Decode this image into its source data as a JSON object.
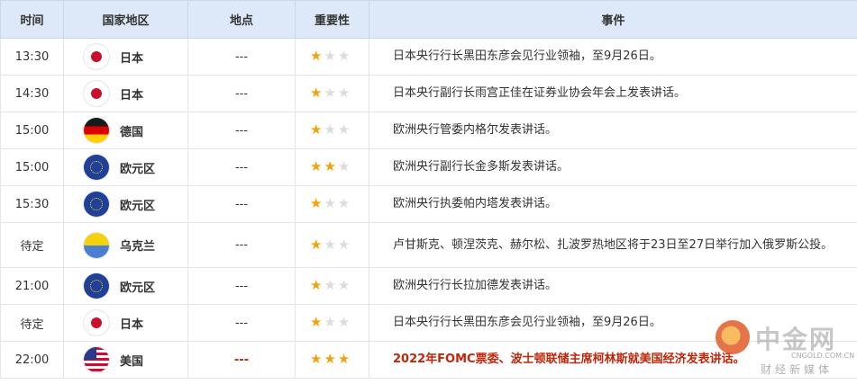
{
  "headers": {
    "time": "时间",
    "country": "国家地区",
    "location": "地点",
    "importance": "重要性",
    "event": "事件"
  },
  "rows": [
    {
      "time": "13:30",
      "flag": "japan-flag-icon",
      "country": "日本",
      "location": "---",
      "stars": 1,
      "event": "日本央行行长黑田东彦会见行业领袖，至9月26日。"
    },
    {
      "time": "14:30",
      "flag": "japan-flag-icon",
      "country": "日本",
      "location": "---",
      "stars": 1,
      "event": "日本央行副行长雨宫正佳在证券业协会年会上发表讲话。"
    },
    {
      "time": "15:00",
      "flag": "germany-flag-icon",
      "country": "德国",
      "location": "---",
      "stars": 1,
      "event": "欧洲央行管委内格尔发表讲话。"
    },
    {
      "time": "15:00",
      "flag": "eu-flag-icon",
      "country": "欧元区",
      "location": "---",
      "stars": 2,
      "event": "欧洲央行副行长金多斯发表讲话。"
    },
    {
      "time": "15:30",
      "flag": "eu-flag-icon",
      "country": "欧元区",
      "location": "---",
      "stars": 1,
      "event": "欧洲央行执委帕内塔发表讲话。"
    },
    {
      "time": "待定",
      "flag": "ukraine-flag-icon",
      "country": "乌克兰",
      "location": "---",
      "stars": 1,
      "event": "卢甘斯克、顿涅茨克、赫尔松、扎波罗热地区将于23日至27日举行加入俄罗斯公投。"
    },
    {
      "time": "21:00",
      "flag": "eu-flag-icon",
      "country": "欧元区",
      "location": "---",
      "stars": 1,
      "event": "欧洲央行行长拉加德发表讲话。"
    },
    {
      "time": "待定",
      "flag": "japan-flag-icon",
      "country": "日本",
      "location": "---",
      "stars": 1,
      "event": "日本央行行长黑田东彦会见行业领袖，至9月26日。"
    },
    {
      "time": "22:00",
      "flag": "us-flag-icon",
      "country": "美国",
      "location": "---",
      "stars": 3,
      "event": "2022年FOMC票委、波士顿联储主席柯林斯就美国经济发表讲话。"
    }
  ],
  "colors": {
    "header_bg": "#dde9f8",
    "star_on": "#f2a20a",
    "star_off": "#dcdcdc",
    "highlight": "#c0260b"
  },
  "watermark": {
    "name": "中金网",
    "url": "CNGOLD.COM.CN",
    "sub": "财经新媒体"
  }
}
